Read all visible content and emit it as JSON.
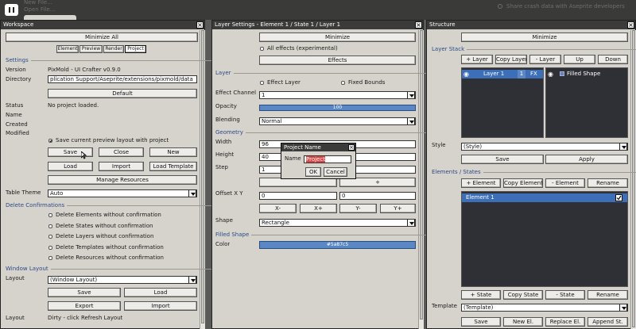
{
  "topbar": {
    "menu_new_file": "New File...",
    "menu_open_file": "Open File...",
    "share_crash": "Share crash data with Aseprite developers"
  },
  "workspace": {
    "title": "Workspace",
    "minimize_all": "Minimize All",
    "tabs": [
      "Element",
      "Preview",
      "Render",
      "Project"
    ],
    "settings_section": "Settings",
    "version_label": "Version",
    "version_value": "PixMold - UI Crafter v0.9.0",
    "directory_label": "Directory",
    "directory_value": "plication Support/Aseprite/extensions/pixmold/data",
    "default_btn": "Default",
    "status_label": "Status",
    "status_value": "No project loaded.",
    "name_label": "Name",
    "created_label": "Created",
    "modified_label": "Modified",
    "save_preview_label": "Save current preview layout with project",
    "save_preview_checked": true,
    "btn_save": "Save",
    "btn_close": "Close",
    "btn_new": "New",
    "btn_load": "Load",
    "btn_import": "Import",
    "btn_load_template": "Load Template",
    "btn_manage_resources": "Manage Resources",
    "table_theme_label": "Table Theme",
    "table_theme_value": "Auto",
    "delete_section": "Delete Confirmations",
    "delete_options": [
      "Delete Elements without confirmation",
      "Delete States without confirmation",
      "Delete Layers without confirmation",
      "Delete Templates without confirmation",
      "Delete Resources without confirmation"
    ],
    "window_layout_section": "Window Layout",
    "layout_label": "Layout",
    "layout_value": "(Window Layout)",
    "wl_save": "Save",
    "wl_load": "Load",
    "wl_export": "Export",
    "wl_import": "Import",
    "layout2_label": "Layout",
    "layout2_value": "Dirty - click Refresh Layout"
  },
  "layer_settings": {
    "title": "Layer Settings - Element 1 / State 1 / Layer 1",
    "minimize": "Minimize",
    "all_effects_label": "All effects (experimental)",
    "effects_btn": "Effects",
    "layer_section": "Layer",
    "effect_layer_label": "Effect Layer",
    "fixed_bounds_label": "Fixed Bounds",
    "effect_channel_label": "Effect Channel",
    "effect_channel_value": "1",
    "opacity_label": "Opacity",
    "opacity_value": "100",
    "opacity_fraction": 1.0,
    "blending_label": "Blending",
    "blending_value": "Normal",
    "geometry_section": "Geometry",
    "width_label": "Width",
    "width_value": "96",
    "height_label": "Height",
    "height_value": "40",
    "step_label": "Step",
    "step_value": "1",
    "plus_btn": "+",
    "offset_label": "Offset X Y",
    "offset_x": "0",
    "offset_y": "0",
    "btn_xminus": "X-",
    "btn_xplus": "X+",
    "btn_yminus": "Y-",
    "btn_yplus": "Y+",
    "shape_label": "Shape",
    "shape_value": "Rectangle",
    "filled_section": "Filled Shape",
    "color_label": "Color",
    "color_value": "#5a87c5",
    "color_swatch": "#5b87c5"
  },
  "dialog": {
    "title": "Project Name",
    "name_label": "Name",
    "name_value": "Project",
    "ok": "OK",
    "cancel": "Cancel"
  },
  "structure": {
    "title": "Structure",
    "minimize": "Minimize",
    "layer_stack_section": "Layer Stack",
    "btn_add_layer": "+ Layer",
    "btn_copy_layer": "Copy Layer",
    "btn_remove_layer": "- Layer",
    "btn_up": "Up",
    "btn_down": "Down",
    "layer_row_label": "Layer 1",
    "layer_row_index": "1",
    "layer_row_fx": "FX",
    "filled_shape_label": "Filled Shape",
    "style_label": "Style",
    "style_value": "(Style)",
    "style_save": "Save",
    "style_apply": "Apply",
    "elements_section": "Elements / States",
    "btn_add_element": "+ Element",
    "btn_copy_element": "Copy Element",
    "btn_remove_element": "- Element",
    "btn_rename": "Rename",
    "element_row_label": "Element 1",
    "btn_add_state": "+ State",
    "btn_copy_state": "Copy State",
    "btn_remove_state": "- State",
    "btn_rename2": "Rename",
    "template_label": "Template",
    "template_value": "(Template)",
    "btn_save": "Save",
    "btn_new_el": "New El.",
    "btn_replace_el": "Replace El.",
    "btn_append_st": "Append St."
  },
  "colors": {
    "accent_blue": "#5b87c5",
    "panel_bg": "#d6d3cc",
    "titlebar": "#3b3b39",
    "list_bg": "#2f2f36",
    "section_text": "#2c4a88"
  }
}
